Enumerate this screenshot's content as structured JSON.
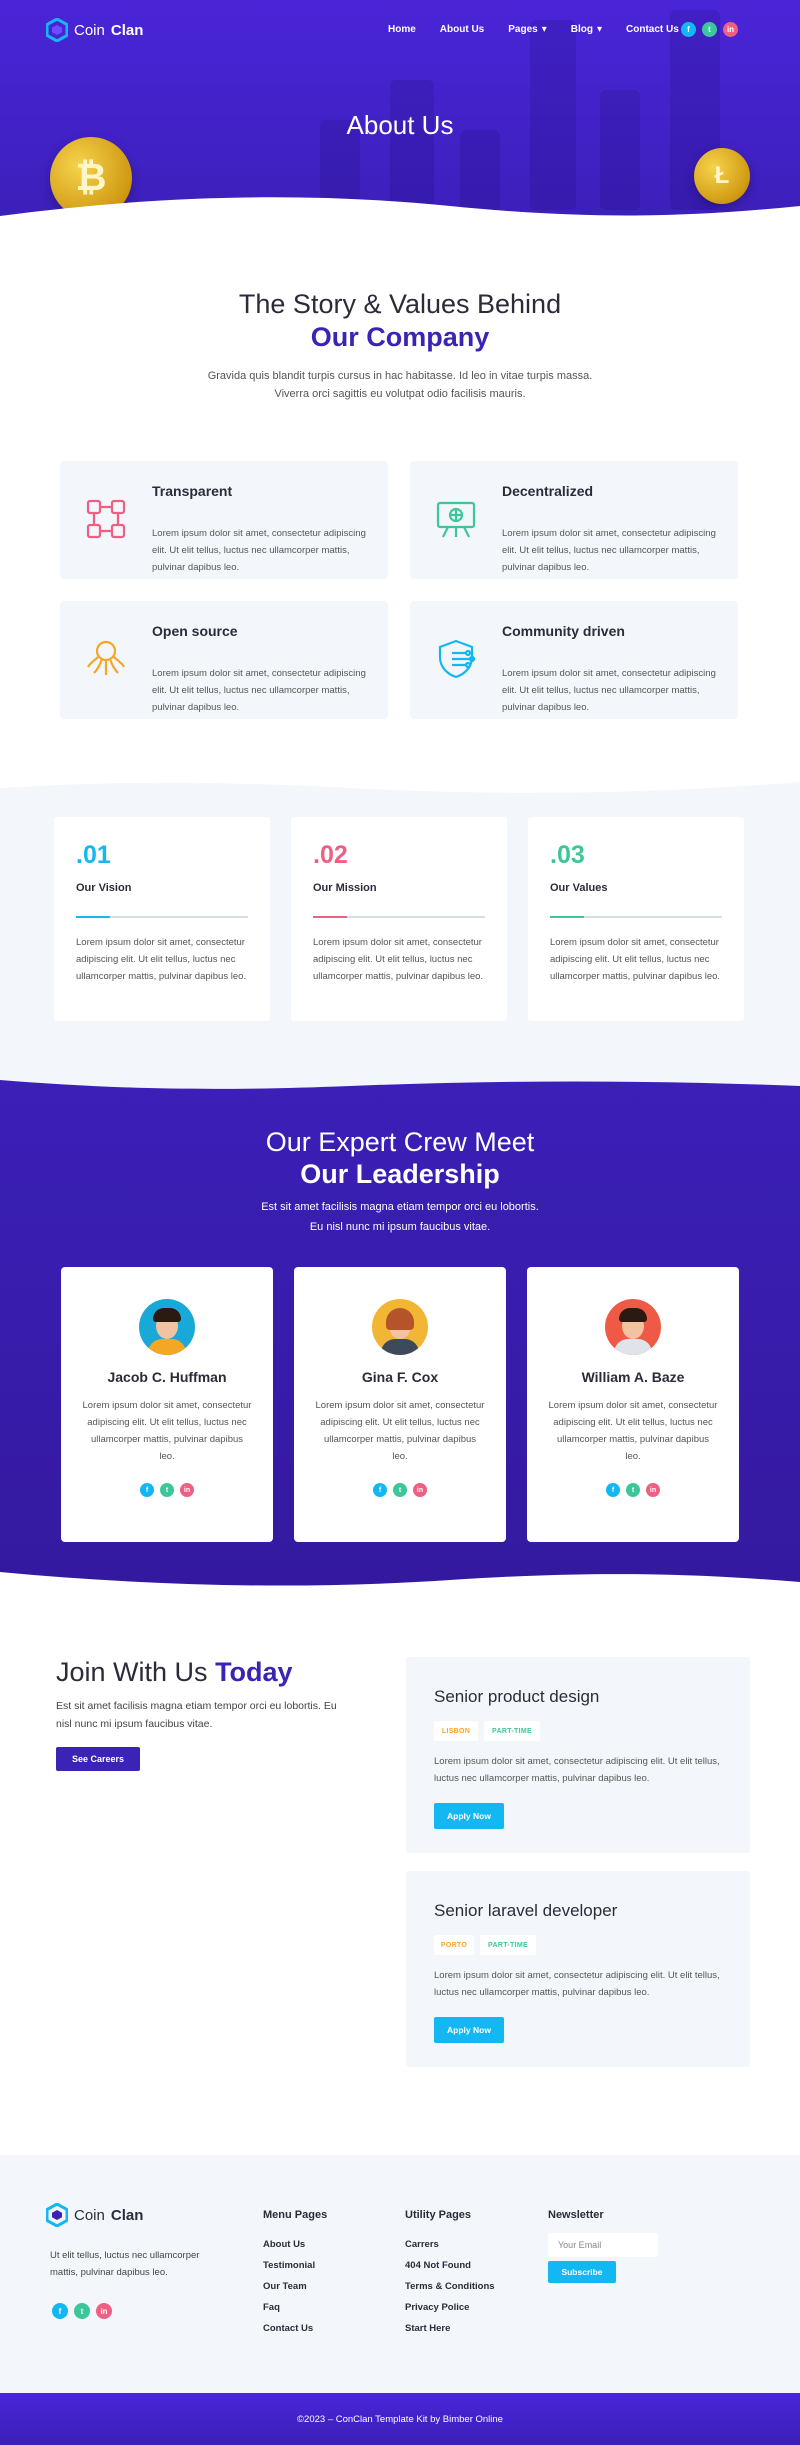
{
  "brand": {
    "name_light": "Coin",
    "name_bold": "Clan"
  },
  "nav": {
    "items": [
      {
        "label": "Home"
      },
      {
        "label": "About Us"
      },
      {
        "label": "Pages",
        "dropdown": true
      },
      {
        "label": "Blog",
        "dropdown": true
      },
      {
        "label": "Contact Us"
      }
    ],
    "social": [
      {
        "icon": "facebook-icon",
        "glyph": "f",
        "color": "#13b8f2"
      },
      {
        "icon": "twitter-icon",
        "glyph": "t",
        "color": "#3cc79a"
      },
      {
        "icon": "linkedin-icon",
        "glyph": "in",
        "color": "#ef5f82"
      }
    ]
  },
  "hero": {
    "title": "About Us"
  },
  "story": {
    "title_line1": "The Story & Values Behind",
    "title_line2": "Our Company",
    "text": "Gravida quis blandit turpis cursus in hac habitasse. Id leo in vitae turpis massa. Viverra orci sagittis eu volutpat odio facilisis mauris."
  },
  "features": [
    {
      "title": "Transparent",
      "icon": "network-icon",
      "text": "Lorem ipsum dolor sit amet, consectetur adipiscing elit. Ut elit tellus, luctus nec ullamcorper mattis, pulvinar dapibus leo."
    },
    {
      "title": "Decentralized",
      "icon": "presentation-icon",
      "text": "Lorem ipsum dolor sit amet, consectetur adipiscing elit. Ut elit tellus, luctus nec ullamcorper mattis, pulvinar dapibus leo."
    },
    {
      "title": "Open source",
      "icon": "octopus-icon",
      "text": "Lorem ipsum dolor sit amet, consectetur adipiscing elit. Ut elit tellus, luctus nec ullamcorper mattis, pulvinar dapibus leo."
    },
    {
      "title": "Community driven",
      "icon": "shield-circuit-icon",
      "text": "Lorem ipsum dolor sit amet, consectetur adipiscing elit. Ut elit tellus, luctus nec ullamcorper mattis, pulvinar dapibus leo."
    }
  ],
  "values": [
    {
      "num": ".01",
      "title": "Our Vision",
      "color": "#13b8f2",
      "text": "Lorem ipsum dolor sit amet, consectetur adipiscing elit. Ut elit tellus, luctus nec ullamcorper mattis, pulvinar dapibus leo."
    },
    {
      "num": ".02",
      "title": "Our Mission",
      "color": "#ef5f82",
      "text": "Lorem ipsum dolor sit amet, consectetur adipiscing elit. Ut elit tellus, luctus nec ullamcorper mattis, pulvinar dapibus leo."
    },
    {
      "num": ".03",
      "title": "Our Values",
      "color": "#3cc79a",
      "text": "Lorem ipsum dolor sit amet, consectetur adipiscing elit. Ut elit tellus, luctus nec ullamcorper mattis, pulvinar dapibus leo."
    }
  ],
  "team": {
    "title_line1": "Our Expert Crew Meet",
    "title_line2": "Our Leadership",
    "text": "Est sit amet facilisis magna etiam tempor orci eu lobortis. Eu nisl nunc mi ipsum faucibus vitae.",
    "members": [
      {
        "name": "Jacob C. Huffman",
        "bg": "#19a9d8",
        "hair": "#2a1a12",
        "shirt": "#f5a623",
        "text": "Lorem ipsum dolor sit amet, consectetur adipiscing elit. Ut elit tellus, luctus nec ullamcorper mattis, pulvinar dapibus leo."
      },
      {
        "name": "Gina F. Cox",
        "bg": "#f2b635",
        "hair": "#b5542a",
        "shirt": "#3e4a5a",
        "text": "Lorem ipsum dolor sit amet, consectetur adipiscing elit. Ut elit tellus, luctus nec ullamcorper mattis, pulvinar dapibus leo."
      },
      {
        "name": "William A. Baze",
        "bg": "#ee5a45",
        "hair": "#2a1a12",
        "shirt": "#dfe3ea",
        "text": "Lorem ipsum dolor sit amet, consectetur adipiscing elit. Ut elit tellus, luctus nec ullamcorper mattis, pulvinar dapibus leo."
      }
    ]
  },
  "careers": {
    "title": "Join With Us",
    "title_accent": "Today",
    "text": "Est sit amet facilisis magna etiam tempor orci eu lobortis. Eu nisl nunc mi ipsum faucibus vitae.",
    "button": "See Careers",
    "jobs": [
      {
        "title": "Senior product design",
        "location": "LISBON",
        "type": "PART-TIME",
        "text": "Lorem ipsum dolor sit amet, consectetur adipiscing elit. Ut elit tellus, luctus nec ullamcorper mattis, pulvinar dapibus leo.",
        "button": "Apply Now"
      },
      {
        "title": "Senior laravel developer",
        "location": "PORTO",
        "type": "PART-TIME",
        "text": "Lorem ipsum dolor sit amet, consectetur adipiscing elit. Ut elit tellus, luctus nec ullamcorper mattis, pulvinar dapibus leo.",
        "button": "Apply Now"
      }
    ]
  },
  "footer": {
    "about": "Ut elit tellus, luctus nec ullamcorper mattis, pulvinar dapibus leo.",
    "menu": {
      "title": "Menu Pages",
      "items": [
        "About Us",
        "Testimonial",
        "Our Team",
        "Faq",
        "Contact Us"
      ]
    },
    "utility": {
      "title": "Utility Pages",
      "items": [
        "Carrers",
        "404 Not Found",
        "Terms & Conditions",
        "Privacy Police",
        "Start Here"
      ]
    },
    "newsletter": {
      "title": "Newsletter",
      "placeholder": "Your Email",
      "button": "Subscribe"
    },
    "copyright": "©2023 – ConClan Template Kit by Bimber Online"
  },
  "colors": {
    "purple": "#3b24b5",
    "cyan": "#13b8f2",
    "pink": "#ef5f82",
    "green": "#3cc79a",
    "orange": "#f5a623"
  }
}
